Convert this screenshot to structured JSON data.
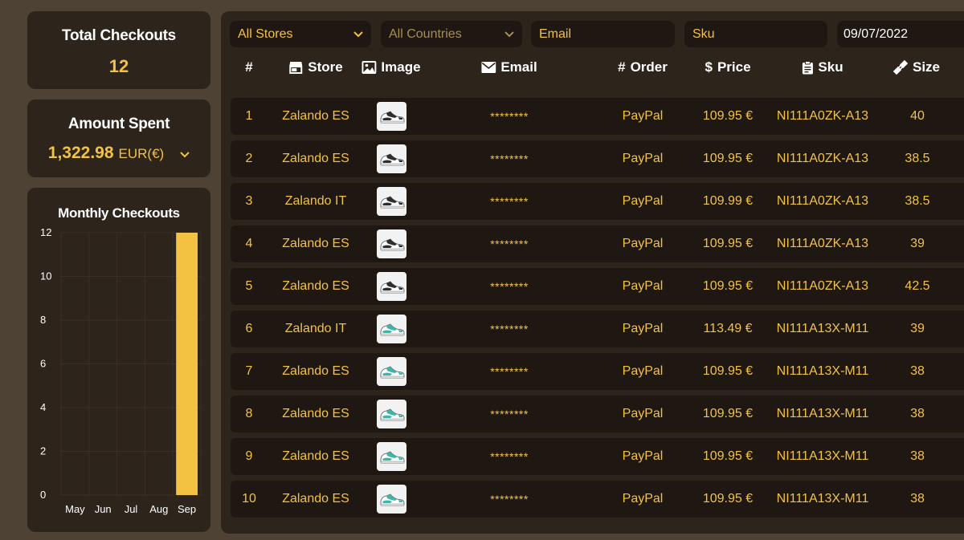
{
  "summary": {
    "total_checkouts_label": "Total Checkouts",
    "total_checkouts_value": "12",
    "amount_spent_label": "Amount Spent",
    "amount_spent_value": "1,322.98",
    "amount_spent_currency": "EUR(€)"
  },
  "filters": {
    "store": "All Stores",
    "country": "All Countries",
    "email_placeholder": "Email",
    "sku_placeholder": "Sku",
    "date": "09/07/2022"
  },
  "table": {
    "columns": [
      "#",
      "Store",
      "Image",
      "Email",
      "Order",
      "Price",
      "Sku",
      "Size"
    ],
    "rows": [
      {
        "num": "1",
        "store": "Zalando ES",
        "shoe": "black-white",
        "email": "********",
        "order": "PayPal",
        "price": "109.95 €",
        "sku": "NI111A0ZK-A13",
        "size": "40"
      },
      {
        "num": "2",
        "store": "Zalando ES",
        "shoe": "black-white",
        "email": "********",
        "order": "PayPal",
        "price": "109.95 €",
        "sku": "NI111A0ZK-A13",
        "size": "38.5"
      },
      {
        "num": "3",
        "store": "Zalando IT",
        "shoe": "black-white",
        "email": "********",
        "order": "PayPal",
        "price": "109.99 €",
        "sku": "NI111A0ZK-A13",
        "size": "38.5"
      },
      {
        "num": "4",
        "store": "Zalando ES",
        "shoe": "black-white",
        "email": "********",
        "order": "PayPal",
        "price": "109.95 €",
        "sku": "NI111A0ZK-A13",
        "size": "39"
      },
      {
        "num": "5",
        "store": "Zalando ES",
        "shoe": "black-white",
        "email": "********",
        "order": "PayPal",
        "price": "109.95 €",
        "sku": "NI111A0ZK-A13",
        "size": "42.5"
      },
      {
        "num": "6",
        "store": "Zalando IT",
        "shoe": "teal-white",
        "email": "********",
        "order": "PayPal",
        "price": "113.49 €",
        "sku": "NI111A13X-M11",
        "size": "39"
      },
      {
        "num": "7",
        "store": "Zalando ES",
        "shoe": "teal-white",
        "email": "********",
        "order": "PayPal",
        "price": "109.95 €",
        "sku": "NI111A13X-M11",
        "size": "38"
      },
      {
        "num": "8",
        "store": "Zalando ES",
        "shoe": "teal-white",
        "email": "********",
        "order": "PayPal",
        "price": "109.95 €",
        "sku": "NI111A13X-M11",
        "size": "38"
      },
      {
        "num": "9",
        "store": "Zalando ES",
        "shoe": "teal-white",
        "email": "********",
        "order": "PayPal",
        "price": "109.95 €",
        "sku": "NI111A13X-M11",
        "size": "38"
      },
      {
        "num": "10",
        "store": "Zalando ES",
        "shoe": "teal-white",
        "email": "********",
        "order": "PayPal",
        "price": "109.95 €",
        "sku": "NI111A13X-M11",
        "size": "38"
      }
    ]
  },
  "colors": {
    "accent": "#f3c243",
    "panel": "#2d241c",
    "row": "#1f1711",
    "background": "#4e4235",
    "shoe_black": "#2e2e2e",
    "shoe_teal": "#3fb5a8"
  },
  "icons": {
    "store": "store-icon",
    "image": "image-icon",
    "email": "envelope-icon",
    "order": "hash-icon",
    "price": "dollar-icon",
    "sku": "clipboard-icon",
    "size": "ruler-icon"
  },
  "chart_data": {
    "type": "bar",
    "title": "Monthly Checkouts",
    "categories": [
      "May",
      "Jun",
      "Jul",
      "Aug",
      "Sep"
    ],
    "values": [
      0,
      0,
      0,
      0,
      12
    ],
    "ylim": [
      0,
      12
    ],
    "yticks": [
      0,
      2,
      4,
      6,
      8,
      10,
      12
    ],
    "xlabel": "",
    "ylabel": "",
    "grid": true,
    "bar_color": "#f3c243"
  }
}
